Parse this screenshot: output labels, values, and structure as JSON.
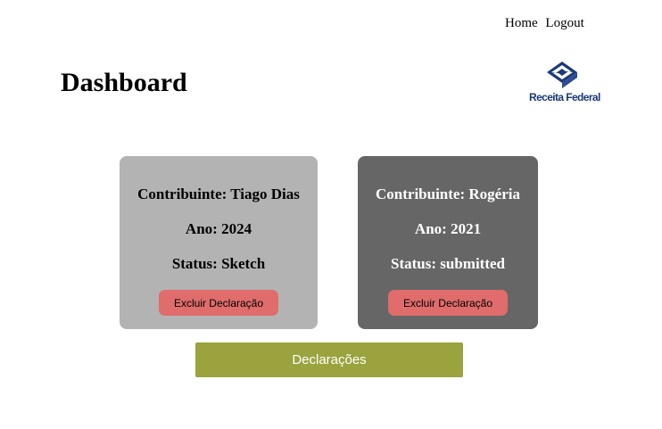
{
  "nav": {
    "home": "Home",
    "logout": "Logout"
  },
  "page_title": "Dashboard",
  "logo": {
    "text": "Receita Federal",
    "icon": "receita-federal-emblem-icon",
    "color": "#1b3a78"
  },
  "cards": [
    {
      "contribuinte": "Contribuinte: Tiago Dias",
      "ano": "Ano: 2024",
      "status": "Status: Sketch",
      "delete_label": "Excluir Declaração",
      "background": "#b3b3b3"
    },
    {
      "contribuinte": "Contribuinte: Rogéria",
      "ano": "Ano: 2021",
      "status": "Status: submitted",
      "delete_label": "Excluir Declaração",
      "background": "#666666"
    }
  ],
  "declaracoes_button": "Declarações",
  "colors": {
    "delete_button": "#e06c6c",
    "primary_button": "#9aa33e"
  }
}
